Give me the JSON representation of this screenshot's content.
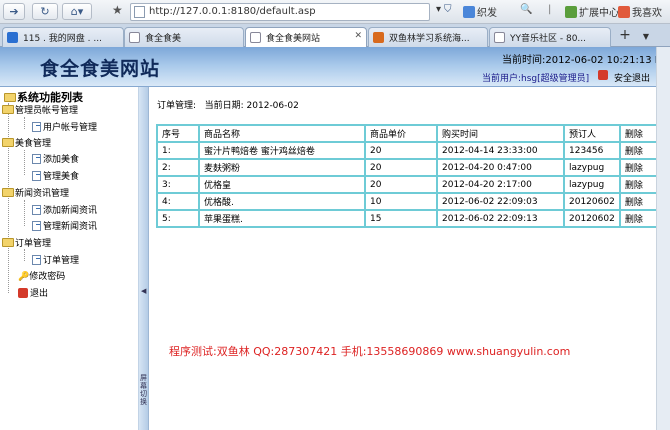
{
  "browser": {
    "address": "http://127.0.0.1:8180/default.asp",
    "search_label": "织发",
    "right_items": [
      "扩展中心",
      "我喜欢"
    ],
    "tabs": [
      {
        "label": "115 . 我的网盘 . ...",
        "active": false
      },
      {
        "label": "食全食美",
        "active": false
      },
      {
        "label": "食全食美网站",
        "active": true
      },
      {
        "label": "双鱼林学习系统海...",
        "active": false
      },
      {
        "label": "YY音乐社区 - 80...",
        "active": false
      }
    ]
  },
  "header": {
    "site_title": "食全食美网站",
    "current_time": "当前时间:2012-06-02 10:21:13 PM",
    "current_user": "当前用户:hsg[超级管理员]",
    "logout": "安全退出"
  },
  "sidebar": {
    "title": "系统功能列表",
    "groups": [
      {
        "label": "管理员帐号管理",
        "items": [
          "用户帐号管理"
        ]
      },
      {
        "label": "美食管理",
        "items": [
          "添加美食",
          "管理美食"
        ]
      },
      {
        "label": "新闻资讯管理",
        "items": [
          "添加新闻资讯",
          "管理新闻资讯"
        ]
      },
      {
        "label": "订单管理",
        "items": [
          "订单管理"
        ]
      }
    ],
    "change_password": "修改密码",
    "exit": "退出",
    "collapse_text": "屏幕切换"
  },
  "main": {
    "section": "订单管理:",
    "date_label": "当前日期: 2012-06-02",
    "columns": [
      "序号",
      "商品名称",
      "商品单价",
      "购买时间",
      "预订人",
      "删除"
    ],
    "rows": [
      {
        "no": "1:",
        "name": "蜜汁片鸭焙卷 蜜汁鸡丝焙卷",
        "price": "20",
        "time": "2012-04-14 23:33:00",
        "user": "123456",
        "action": "删除"
      },
      {
        "no": "2:",
        "name": "麦麸粥粉",
        "price": "20",
        "time": "2012-04-20 0:47:00",
        "user": "lazypug",
        "action": "删除"
      },
      {
        "no": "3:",
        "name": "优格皇",
        "price": "20",
        "time": "2012-04-20 2:17:00",
        "user": "lazypug",
        "action": "删除"
      },
      {
        "no": "4:",
        "name": "优格酸.",
        "price": "10",
        "time": "2012-06-02 22:09:03",
        "user": "20120602",
        "action": "删除"
      },
      {
        "no": "5:",
        "name": "苹果蛋糕.",
        "price": "15",
        "time": "2012-06-02 22:09:13",
        "user": "20120602",
        "action": "删除"
      }
    ],
    "footer": "程序测试:双鱼林 QQ:287307421 手机:13558690869 www.shuangyulin.com"
  }
}
